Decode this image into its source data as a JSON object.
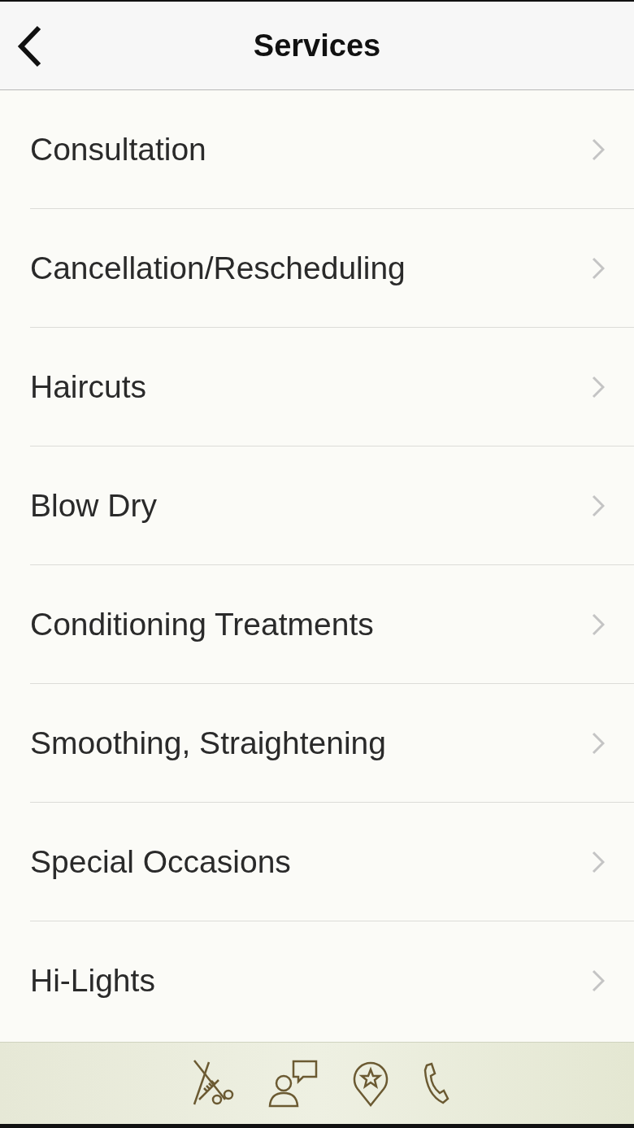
{
  "header": {
    "title": "Services"
  },
  "items": [
    {
      "label": "Consultation"
    },
    {
      "label": "Cancellation/Rescheduling"
    },
    {
      "label": "Haircuts"
    },
    {
      "label": "Blow Dry"
    },
    {
      "label": "Conditioning Treatments"
    },
    {
      "label": "Smoothing, Straightening"
    },
    {
      "label": "Special Occasions"
    },
    {
      "label": "Hi-Lights"
    }
  ]
}
